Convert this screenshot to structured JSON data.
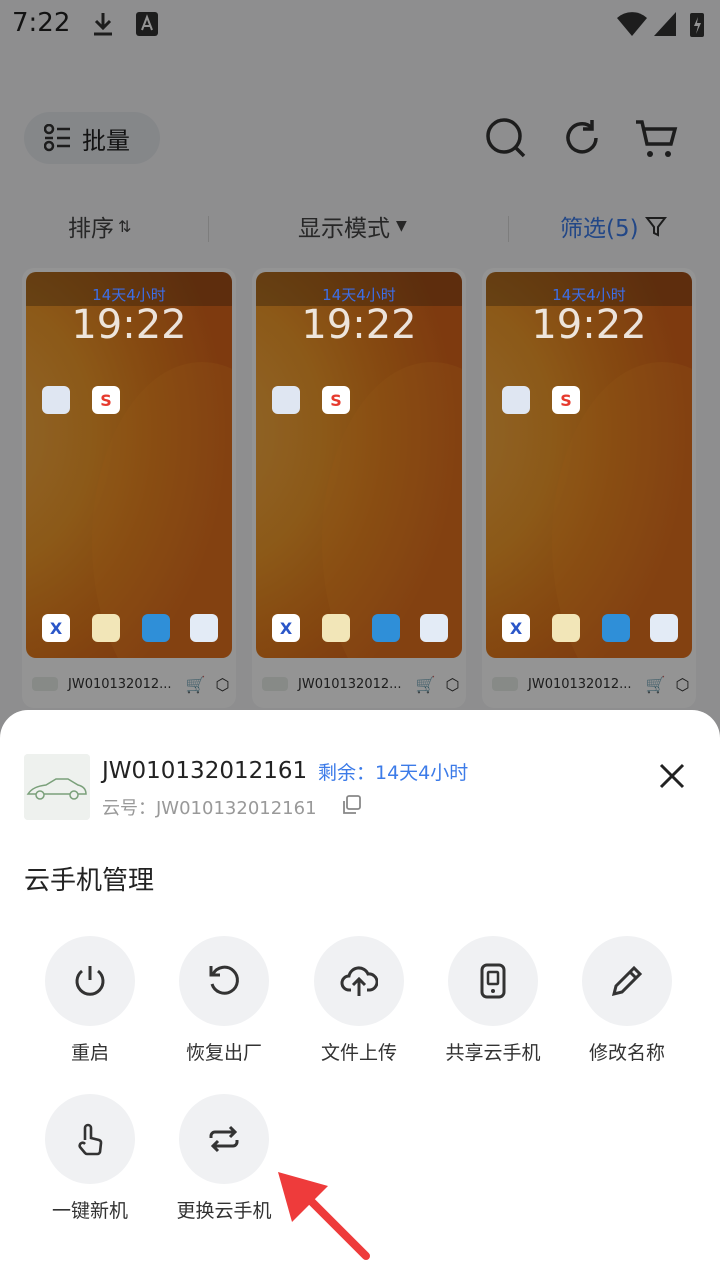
{
  "status_bar": {
    "time": "7:22"
  },
  "toolbar": {
    "batch_label": "批量"
  },
  "filter_bar": {
    "sort_label": "排序",
    "display_label": "显示模式",
    "filter_label": "筛选(5)"
  },
  "cards": [
    {
      "remaining": "14天4小时",
      "clock": "19:22",
      "id": "JW010132012..."
    },
    {
      "remaining": "14天4小时",
      "clock": "19:22",
      "id": "JW010132012..."
    },
    {
      "remaining": "14天4小时",
      "clock": "19:22",
      "id": "JW010132012..."
    }
  ],
  "sheet": {
    "device_name": "JW010132012161",
    "remaining": "剩余：14天4小时",
    "cloud_id": "云号：JW010132012161",
    "section_title": "云手机管理",
    "actions": [
      {
        "label": "重启",
        "icon": "power-icon"
      },
      {
        "label": "恢复出厂",
        "icon": "reset-icon"
      },
      {
        "label": "文件上传",
        "icon": "cloud-upload-icon"
      },
      {
        "label": "共享云手机",
        "icon": "share-phone-icon"
      },
      {
        "label": "修改名称",
        "icon": "pencil-icon"
      },
      {
        "label": "一键新机",
        "icon": "tap-hand-icon"
      },
      {
        "label": "更换云手机",
        "icon": "swap-icon"
      }
    ]
  },
  "colors": {
    "accent": "#3c7be8",
    "annotation_arrow": "#ee3b3b"
  }
}
